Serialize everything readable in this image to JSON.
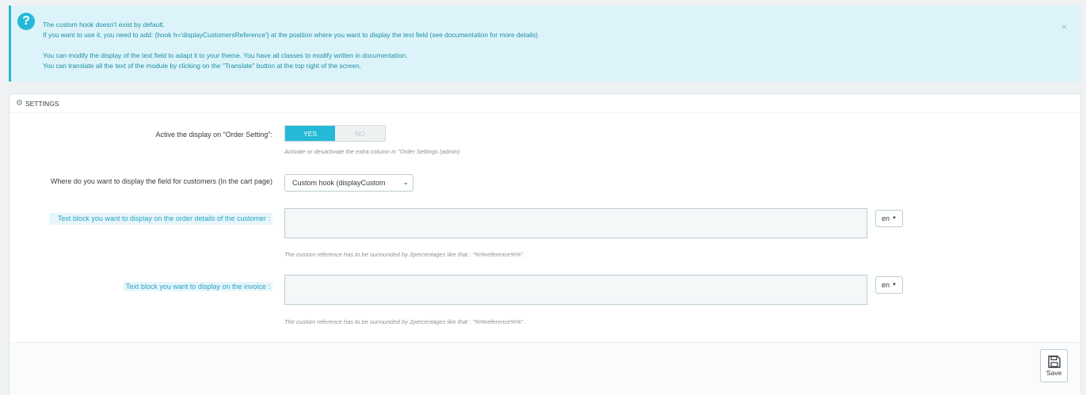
{
  "alert": {
    "icon": "question-circle-icon",
    "lines": [
      "The custom hook doesn't exist by default.",
      "If you want to use it, you need to add: {hook h='displayCustomersReference'} at the position where you want to display the text field (see documentation for more details)",
      "You can modify the display of the text field to adapt it to your theme. You have all classes to modify written in documentation.",
      "You can translate all the text of the module by clicking on the \"Translate\" button at the top right of the screen."
    ],
    "close": "×"
  },
  "panel": {
    "title": "SETTINGS",
    "title_icon": "gears-icon"
  },
  "form": {
    "display_order_label": "Active the display on \"Order Setting\":",
    "switch_yes": "YES",
    "switch_no": "NO",
    "switch_value": "YES",
    "display_order_help": "Activate or desactivate the extra column in \"Order Settings (admin)",
    "field_location_label": "Where do you want to display the field for customers (In the cart page)",
    "field_location_value": "Custom hook (displayCustom",
    "order_details_label": "Text block you want to display on the order details of the customer :",
    "order_details_value": "",
    "order_details_lang": "en",
    "order_details_help": "The custom reference has to be surrounded by 2percentages like that : \"%%reference%%\".",
    "invoice_label": "Text block you want to display on the invoice :",
    "invoice_value": "",
    "invoice_lang": "en",
    "invoice_help": "The custom reference has to be surrounded by 2percentages like that : \"%%reference%%\"."
  },
  "footer": {
    "save_label": "Save",
    "save_icon": "floppy-disk-icon"
  },
  "colors": {
    "accent": "#25b9d7",
    "alert_bg": "#dcf4f9",
    "alert_text": "#1e8ea6"
  }
}
